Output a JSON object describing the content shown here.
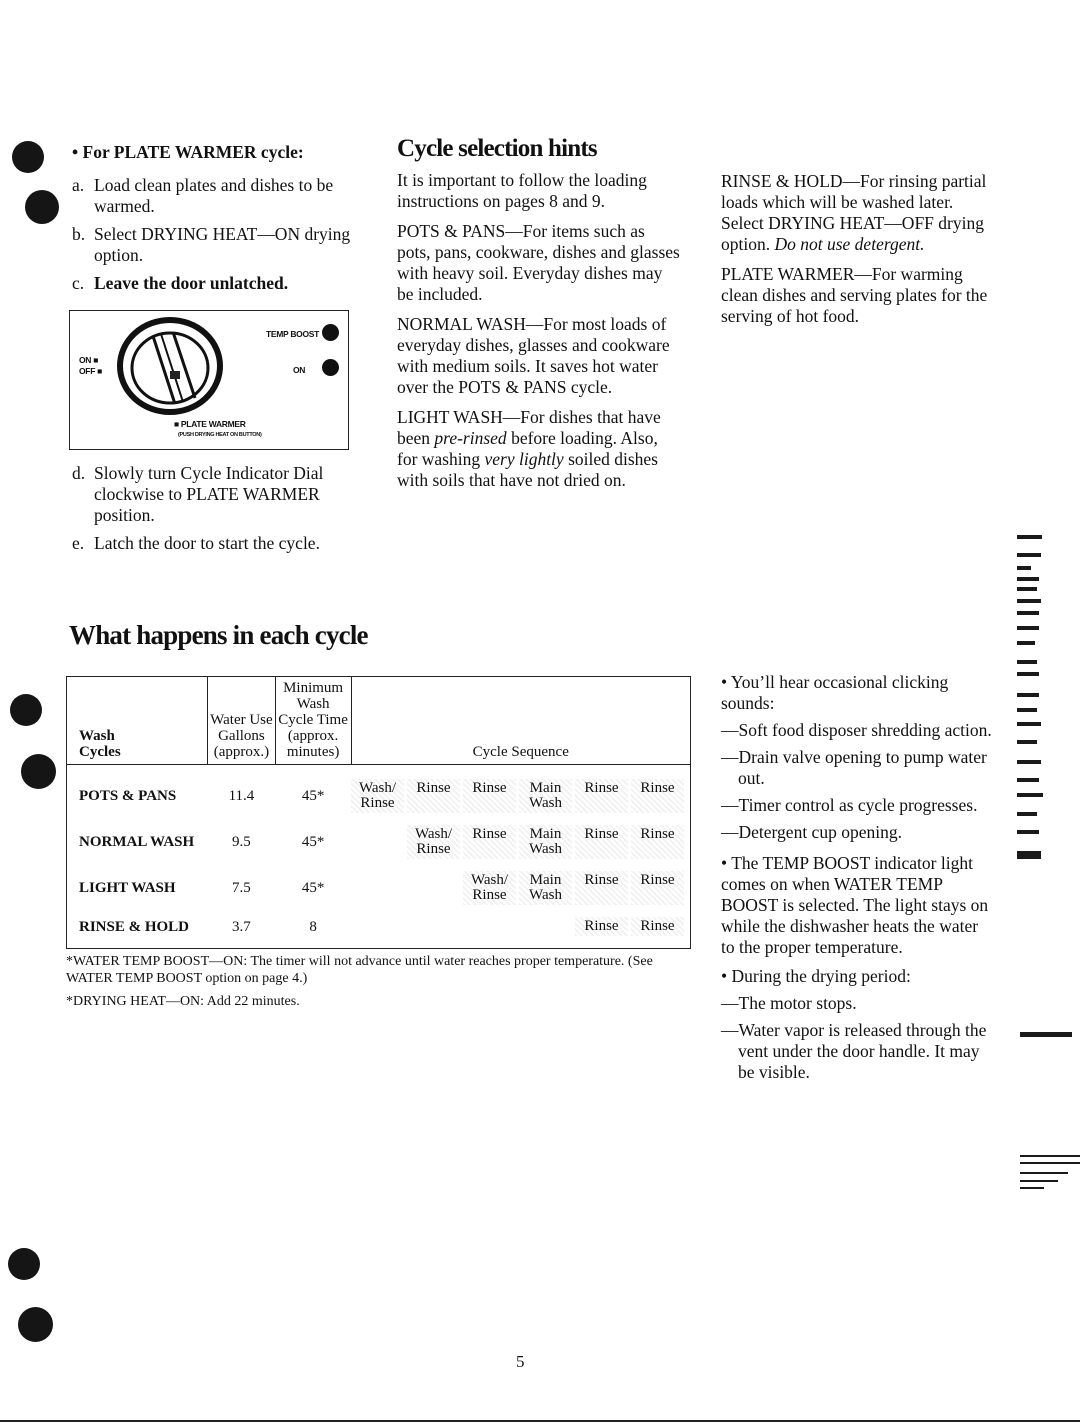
{
  "left_column": {
    "heading": "For PLATE WARMER cycle:",
    "steps": [
      {
        "marker": "a.",
        "text": "Load clean plates and dishes to be warmed.",
        "bold": false
      },
      {
        "marker": "b.",
        "text": "Select DRYING HEAT—ON drying option.",
        "bold": false
      },
      {
        "marker": "c.",
        "text": "Leave the door unlatched.",
        "bold": true
      },
      {
        "marker": "d.",
        "text": "Slowly turn Cycle Indicator Dial clockwise to PLATE WARMER position.",
        "bold": false
      },
      {
        "marker": "e.",
        "text": "Latch the door to start the cycle.",
        "bold": false
      }
    ],
    "panel_figure": {
      "temp_boost_label": "TEMP BOOST",
      "on_label": "ON",
      "dial_on": "ON",
      "dial_off": "OFF",
      "plate_warmer_label": "PLATE WARMER",
      "plate_warmer_note": "(PUSH DRYING HEAT ON BUTTON)"
    }
  },
  "hints": {
    "heading": "Cycle selection hints",
    "intro": "It is important to follow the loading instructions on pages 8 and 9.",
    "pots_pans": "POTS & PANS—For items such as pots, pans, cookware, dishes and glasses with heavy soil. Everyday dishes may be included.",
    "normal_wash": "NORMAL WASH—For most loads of everyday dishes, glasses and cookware with medium soils. It saves hot water over the POTS & PANS cycle.",
    "light_wash": {
      "a": "LIGHT WASH—For dishes that have been ",
      "b_italic": "pre-rinsed",
      "c": " before loading. Also, for washing ",
      "d_italic": "very lightly",
      "e": " soiled dishes with soils that have not dried on."
    },
    "rinse_hold": {
      "a": "RINSE & HOLD—For rinsing partial loads which will be washed later. Select DRYING HEAT—OFF drying option. ",
      "b_italic": "Do not use detergent."
    },
    "plate_warmer": "PLATE WARMER—For warming clean dishes and serving plates for the serving of hot food."
  },
  "cycle_section": {
    "heading": "What happens in each cycle",
    "table": {
      "headers": {
        "wash_cycles": [
          "Wash",
          "Cycles"
        ],
        "water_use": [
          "Water Use",
          "Gallons",
          "(approx.)"
        ],
        "min_time": [
          "Minimum",
          "Wash",
          "Cycle Time",
          "(approx.",
          "minutes)"
        ],
        "sequence": "Cycle Sequence"
      },
      "rows": [
        {
          "cycle": "POTS & PANS",
          "gallons": "11.4",
          "minutes": "45*",
          "sequence": [
            "Wash/ Rinse",
            "Rinse",
            "Rinse",
            "Main Wash",
            "Rinse",
            "Rinse"
          ]
        },
        {
          "cycle": "NORMAL WASH",
          "gallons": "9.5",
          "minutes": "45*",
          "sequence": [
            "",
            "Wash/ Rinse",
            "Rinse",
            "Main Wash",
            "Rinse",
            "Rinse"
          ]
        },
        {
          "cycle": "LIGHT WASH",
          "gallons": "7.5",
          "minutes": "45*",
          "sequence": [
            "",
            "",
            "Wash/ Rinse",
            "Main Wash",
            "Rinse",
            "Rinse"
          ]
        },
        {
          "cycle": "RINSE & HOLD",
          "gallons": "3.7",
          "minutes": "8",
          "sequence": [
            "",
            "",
            "",
            "",
            "Rinse",
            "Rinse"
          ]
        }
      ]
    },
    "footnotes": [
      "*WATER TEMP BOOST—ON: The timer will not advance until water reaches proper temperature. (See WATER TEMP BOOST option on page 4.)",
      "*DRYING HEAT—ON: Add 22 minutes."
    ]
  },
  "right_notes": {
    "clicking_intro": "You’ll hear occasional clicking sounds:",
    "clicking_items": [
      "—Soft food disposer shredding action.",
      "—Drain valve opening to pump water out.",
      "—Timer control as cycle progresses.",
      "—Detergent cup opening."
    ],
    "temp_boost": "The TEMP BOOST indicator light comes on when WATER TEMP BOOST is selected. The light stays on while the dishwasher heats the water to the proper temperature.",
    "drying_intro": "During the drying period:",
    "drying_items": [
      "—The motor stops.",
      "—Water vapor is released through the vent under the door handle. It may be visible."
    ]
  },
  "page_number": "5"
}
